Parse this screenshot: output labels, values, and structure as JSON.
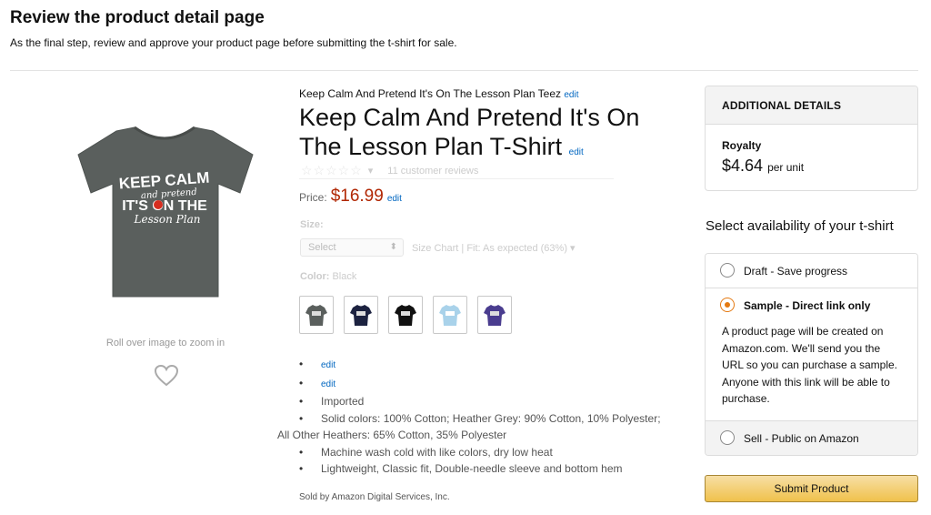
{
  "header": {
    "title": "Review the product detail page",
    "subtitle": "As the final step, review and approve your product page before submitting the t-shirt for sale."
  },
  "image_area": {
    "shirt_text_1": "KEEP CALM",
    "shirt_text_2": "and pretend",
    "shirt_text_3": "IT'S ON THE",
    "shirt_text_4": "Lesson Plan",
    "zoom_hint": "Roll over image to zoom in"
  },
  "product": {
    "brand": "Keep Calm And Pretend It's On The Lesson Plan Teez",
    "edit_label": "edit",
    "title": "Keep Calm And Pretend It's On The Lesson Plan T-Shirt",
    "stars": "☆☆☆☆☆",
    "rating_arrow": "▾",
    "reviews": "11 customer reviews",
    "price_label": "Price:",
    "price": "$16.99",
    "size_label": "Size:",
    "size_select": "Select",
    "size_meta": "Size Chart  |  Fit: As expected (63%)  ▾",
    "color_label": "Color:",
    "color_value": "Black",
    "swatch_colors": [
      "#5a5f5d",
      "#1c2240",
      "#111111",
      "#a9d2ea",
      "#4a3d8f"
    ],
    "bullets": [
      "edit",
      "edit",
      "Imported",
      "Solid colors: 100% Cotton; Heather Grey: 90% Cotton, 10% Polyester;",
      "All Other Heathers: 65% Cotton, 35% Polyester",
      "Machine wash cold with like colors, dry low heat",
      "Lightweight, Classic fit, Double-needle sleeve and bottom hem"
    ],
    "sold_by": "Sold by Amazon Digital Services, Inc."
  },
  "details": {
    "heading": "ADDITIONAL DETAILS",
    "royalty_label": "Royalty",
    "royalty_value": "$4.64",
    "royalty_unit": "per unit"
  },
  "availability": {
    "title": "Select availability of your t-shirt",
    "options": [
      {
        "label": "Draft - Save progress",
        "selected": false
      },
      {
        "label": "Sample - Direct link only",
        "selected": true,
        "description": "A product page will be created on Amazon.com. We'll send you the URL so you can purchase a sample. Anyone with this link will be able to purchase."
      },
      {
        "label": "Sell - Public on Amazon",
        "selected": false
      }
    ]
  },
  "submit_label": "Submit Product",
  "colors": {
    "price": "#b12704",
    "link": "#0066c0",
    "radio_selected": "#e47911",
    "shirt": "#5a5f5d"
  }
}
